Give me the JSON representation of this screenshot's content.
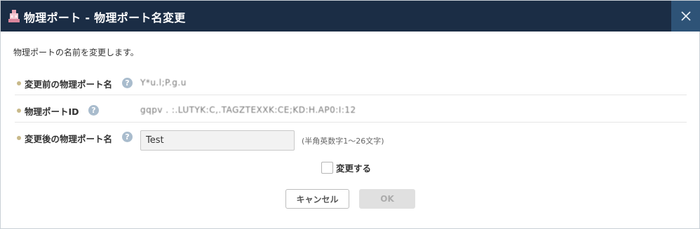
{
  "dialog": {
    "title": "物理ポート - 物理ポート名変更",
    "close_icon": "close-icon",
    "app_icon": "port-icon"
  },
  "description": "物理ポートの名前を変更します。",
  "fields": {
    "old_name": {
      "label": "変更前の物理ポート名",
      "value": "Y*u.l;P.g.u",
      "help_icon": "help-icon"
    },
    "port_id": {
      "label": "物理ポートID",
      "value": "gqpv . :.LUTYK:C,.TAGZTEXXK:CE;KD:H.AP0:I:12",
      "help_icon": "help-icon"
    },
    "new_name": {
      "label": "変更後の物理ポート名",
      "value": "Test",
      "hint": "(半角英数字1～26文字)",
      "help_icon": "help-icon"
    }
  },
  "confirm_checkbox": {
    "label": "変更する",
    "checked": false
  },
  "buttons": {
    "cancel": "キャンセル",
    "ok": "OK"
  },
  "colors": {
    "titlebar": "#1b2d45",
    "close_button": "#2e5377",
    "bullet": "#c8b98a",
    "help_icon": "#a9bccd",
    "ok_disabled": "#e0e0e0"
  }
}
